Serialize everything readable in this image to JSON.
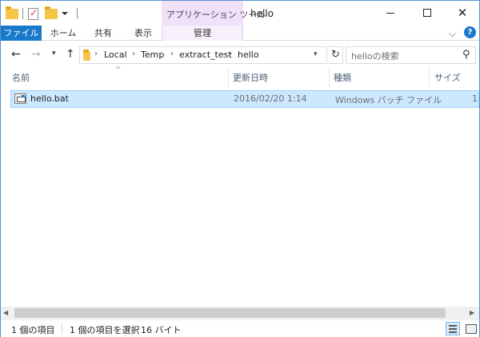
{
  "window": {
    "title": "hello",
    "tool_tab_group": "アプリケーション ツール"
  },
  "ribbon": {
    "tabs": [
      "ファイル",
      "ホーム",
      "共有",
      "表示",
      "管理"
    ],
    "active_color": "#1979ca",
    "tool_color": "#f0e1f8",
    "help_symbol": "?"
  },
  "address": {
    "segments": [
      "Local",
      "Temp",
      "extract_test",
      "hello"
    ],
    "separator": "›"
  },
  "search": {
    "placeholder": "helloの検索"
  },
  "columns": [
    "名前",
    "更新日時",
    "種類",
    "サイズ"
  ],
  "files": [
    {
      "name": "hello.bat",
      "modified": "2016/02/20 1:14",
      "type": "Windows バッチ ファイル",
      "size": "1"
    }
  ],
  "status": {
    "item_count": "1 個の項目",
    "selection": "1 個の項目を選択",
    "size": "16 バイト"
  }
}
